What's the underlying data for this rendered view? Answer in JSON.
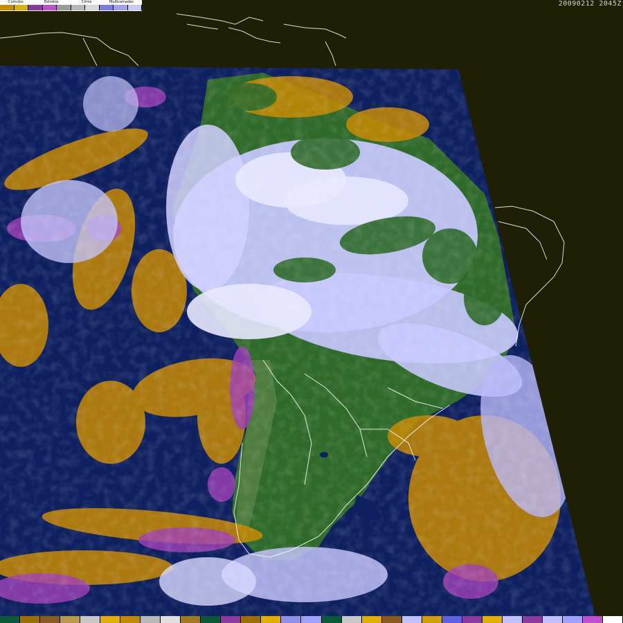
{
  "timestamp": "20090212 2045Z",
  "legend": {
    "labels": [
      "Cúmulos",
      "Estratos",
      "Cirros",
      "Multicamadas"
    ],
    "swatches": [
      "#c88a00",
      "#e0b000",
      "#8c3aa0",
      "#c050d0",
      "#9a9a9a",
      "#b8b8b8",
      "#d8d8d8",
      "#7a7ae8",
      "#a0a0f0",
      "#c8c8ff"
    ]
  },
  "colorbar": [
    "#0a5a3a",
    "#9a7000",
    "#8a5a20",
    "#b89a4a",
    "#c8c8c8",
    "#e0b000",
    "#c08a00",
    "#b8b8b8",
    "#e0e0e0",
    "#a07820",
    "#0a5a3a",
    "#8c3aa0",
    "#9a7000",
    "#e0b000",
    "#9090e8",
    "#a0a0ff",
    "#0a5a3a",
    "#c8c8c8",
    "#e0b000",
    "#8a5a20",
    "#c0c0ff",
    "#d0a000",
    "#6060e0",
    "#8c3aa0",
    "#e0b000",
    "#c0c0ff",
    "#8c3aa0",
    "#c0c0ff",
    "#a0a0ff",
    "#c050d0",
    "#ffffff"
  ],
  "colors": {
    "background": "#1f1f05",
    "ocean": "#0f2060",
    "land": "#2f6a2a",
    "cloud": "#c8c8ff",
    "cumulus": "#c88a00",
    "stratus": "#b050c0",
    "coastline": "#ffffff"
  }
}
